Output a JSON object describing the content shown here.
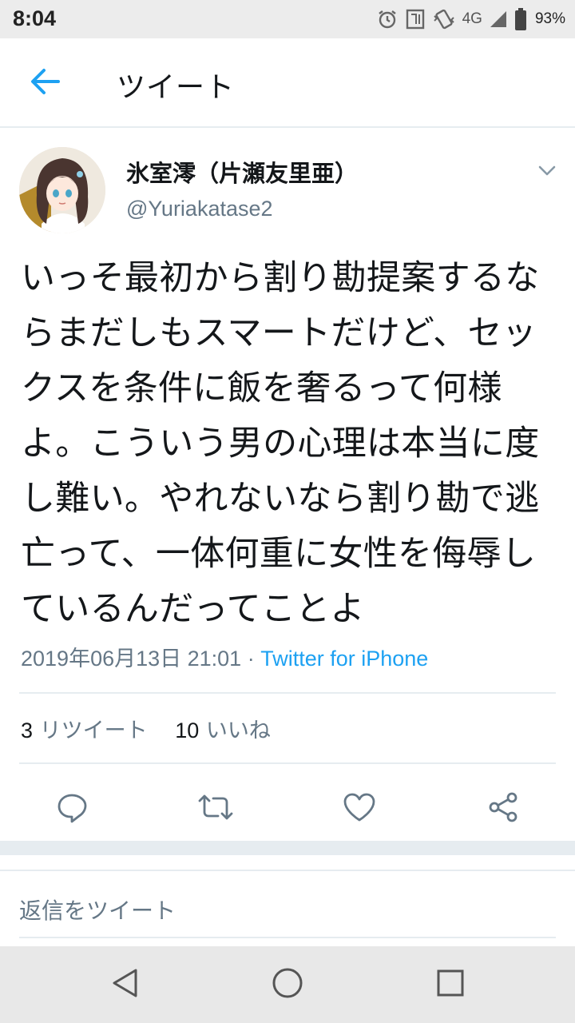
{
  "status_bar": {
    "time": "8:04",
    "network": "4G",
    "battery": "93%",
    "icons": [
      "alarm-icon",
      "nfc-icon",
      "vibrate-icon",
      "signal-icon",
      "battery-icon"
    ]
  },
  "header": {
    "back_icon": "arrow-left-icon",
    "title": "ツイート"
  },
  "tweet": {
    "display_name": "氷室澪（片瀬友里亜）",
    "username": "@Yuriakatase2",
    "text": "いっそ最初から割り勘提案するならまだしもスマートだけど、セックスを条件に飯を奢るって何様よ。こういう男の心理は本当に度し難い。やれないなら割り勘で逃亡って、一体何重に女性を侮辱しているんだってことよ",
    "timestamp": "2019年06月13日 21:01",
    "separator": " · ",
    "source": "Twitter for iPhone",
    "retweet_count": "3",
    "retweet_label": "リツイート",
    "like_count": "10",
    "like_label": "いいね",
    "actions": [
      "reply-icon",
      "retweet-icon",
      "like-icon",
      "share-icon"
    ]
  },
  "reply": {
    "placeholder": "返信をツイート"
  },
  "nav": [
    "back-triangle-icon",
    "home-circle-icon",
    "recents-square-icon"
  ],
  "colors": {
    "accent": "#1da1f2",
    "secondary_text": "#657786",
    "primary_text": "#14171a",
    "divider": "#e6ecf0"
  }
}
